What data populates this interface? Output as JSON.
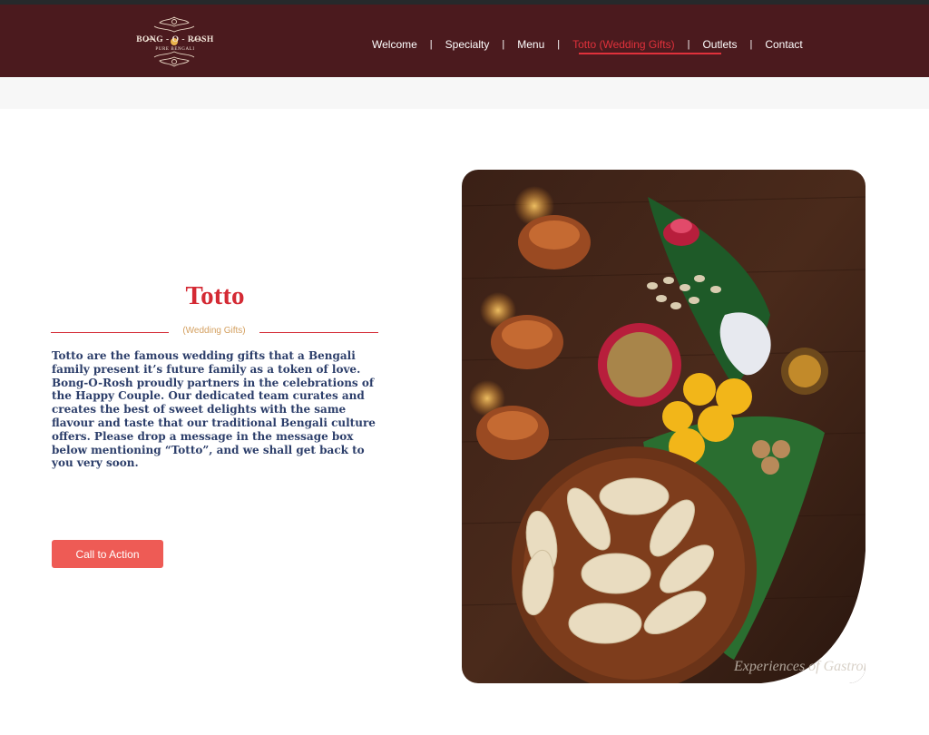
{
  "brand": {
    "name": "BONG - O - ROSH",
    "tagline": "PURE BENGALI"
  },
  "nav": {
    "items": [
      {
        "label": "Welcome"
      },
      {
        "label": "Specialty"
      },
      {
        "label": "Menu"
      },
      {
        "label": "Totto (Wedding Gifts)",
        "active": true
      },
      {
        "label": "Outlets"
      },
      {
        "label": "Contact"
      }
    ],
    "separator": "|"
  },
  "main": {
    "title": "Totto",
    "subtitle": "(Wedding Gifts)",
    "body": "Totto are the famous wedding gifts that a Bengali family present it’s future family as a token of love. Bong-O-Rosh proudly partners in the celebrations of the Happy Couple. Our dedicated team curates and creates the best of sweet delights with the same flavour and taste that our traditional Bengali culture offers. Please drop a message in the message box below mentioning “Totto”, and we shall get back to you very soon.",
    "cta_label": "Call to Action"
  },
  "image": {
    "watermark": "Experiences of Gastronomy"
  },
  "colors": {
    "header_bg": "#4b1a1e",
    "accent": "#e0313b",
    "title": "#d42a34",
    "body_text": "#2c3e6a",
    "button": "#ee5b55",
    "subtitle": "#d4a060"
  }
}
